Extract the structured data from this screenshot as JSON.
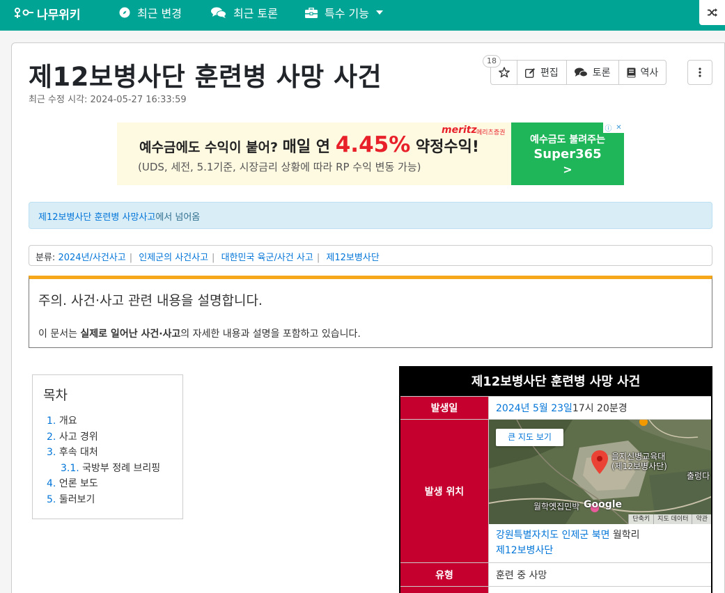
{
  "nav": {
    "logo": "나무위키",
    "recent_changes": "최근 변경",
    "recent_discuss": "최근 토론",
    "special": "특수 기능"
  },
  "article": {
    "title": "제12보병사단 훈련병 사망 사건",
    "last_modified": "최근 수정 시각: 2024-05-27 16:33:59"
  },
  "toolbar": {
    "star_count": "18",
    "edit": "편집",
    "discuss": "토론",
    "history": "역사"
  },
  "ad": {
    "brand": "meritz",
    "brand_sub": "메리츠증권",
    "headline_a": "예수금에도 수익이 붙어? ",
    "headline_b": "매일 연 ",
    "headline_rate": "4.45%",
    "headline_c": " 약정수익!",
    "subline": "(UDS, 세전, 5.1기준, 시장금리 상황에 따라 RP 수익 변동 가능)",
    "cta_line1": "예수금도 불려주는",
    "cta_line2": "Super365",
    "cta_arrow": ">"
  },
  "redirect": {
    "link": "제12보병사단 훈련병 사망사고",
    "suffix": "에서 넘어옴"
  },
  "categories": {
    "label": "분류",
    "items": [
      "2024년/사건사고",
      "인제군의 사건사고",
      "대한민국 육군/사건 사고",
      "제12보병사단"
    ]
  },
  "notice": {
    "title": "주의. 사건·사고 관련 내용을 설명합니다.",
    "text_a": "이 문서는 ",
    "text_b": "실제로 일어난 사건·사고",
    "text_c": "의 자세한 내용과 설명을 포함하고 있습니다."
  },
  "toc": {
    "title": "목차",
    "items": [
      {
        "num": "1.",
        "label": "개요"
      },
      {
        "num": "2.",
        "label": "사고 경위"
      },
      {
        "num": "3.",
        "label": "후속 대처"
      },
      {
        "num": "3.1.",
        "label": "국방부 정례 브리핑"
      },
      {
        "num": "4.",
        "label": "언론 보도"
      },
      {
        "num": "5.",
        "label": "둘러보기"
      }
    ]
  },
  "infobox": {
    "title": "제12보병사단 훈련병 사망 사건",
    "date_label": "발생일",
    "date_link": "2024년 5월 23일",
    "date_time": " 17시 20분경",
    "location_label": "발생 위치",
    "map_button": "큰 지도 보기",
    "map_pin_label_1": "을지신병교육대",
    "map_pin_label_2": "(제12보병사단)",
    "map_place_1": "월학옛집민박",
    "map_place_2": "출렁다",
    "map_google": "Google",
    "map_footer": [
      "단축키",
      "지도 데이터",
      "약관"
    ],
    "addr_link": "강원특별자치도 인제군 북면",
    "addr_rest": " 월학리",
    "addr_line2": "제12보병사단",
    "type_label": "유형",
    "type_value": "훈련 중 사망"
  },
  "colors": {
    "nav_bg": "#00a495",
    "infobox_label": "#c5002e",
    "notice_accent": "#f7a81a",
    "link": "#0275d8"
  }
}
